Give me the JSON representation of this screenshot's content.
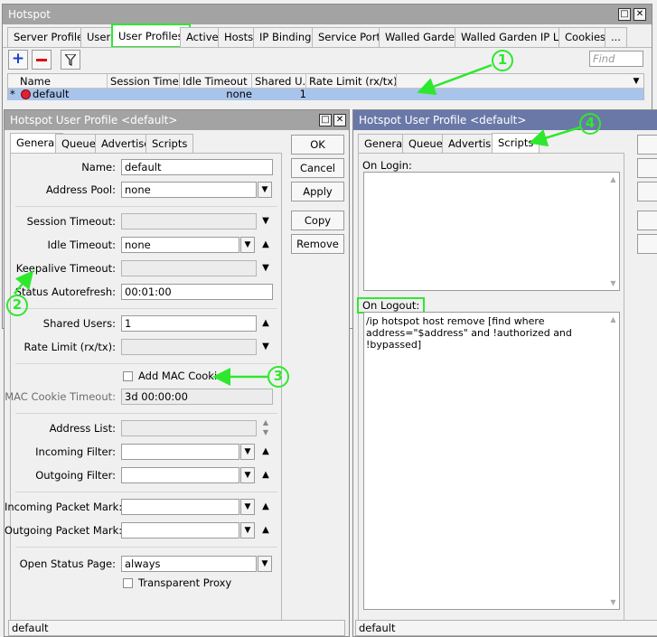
{
  "main": {
    "title": "Hotspot",
    "tabs": [
      "Server Profiles",
      "Users",
      "User Profiles",
      "Active",
      "Hosts",
      "IP Bindings",
      "Service Ports",
      "Walled Garden",
      "Walled Garden IP List",
      "Cookies",
      "..."
    ],
    "find_placeholder": "Find",
    "columns": [
      "Name",
      "Session Time...",
      "Idle Timeout",
      "Shared U...",
      "Rate Limit (rx/tx)"
    ],
    "row": {
      "marker": "*",
      "name": "default",
      "idle_timeout": "none",
      "shared_users": "1"
    }
  },
  "general_dialog": {
    "title": "Hotspot User Profile <default>",
    "tabs": [
      "General",
      "Queue",
      "Advertise",
      "Scripts"
    ],
    "buttons": {
      "ok": "OK",
      "cancel": "Cancel",
      "apply": "Apply",
      "copy": "Copy",
      "remove": "Remove"
    },
    "fields": {
      "name_label": "Name:",
      "name_value": "default",
      "address_pool_label": "Address Pool:",
      "address_pool_value": "none",
      "session_timeout_label": "Session Timeout:",
      "idle_timeout_label": "Idle Timeout:",
      "idle_timeout_value": "none",
      "keepalive_timeout_label": "Keepalive Timeout:",
      "status_autorefresh_label": "Status Autorefresh:",
      "status_autorefresh_value": "00:01:00",
      "shared_users_label": "Shared Users:",
      "shared_users_value": "1",
      "rate_limit_label": "Rate Limit (rx/tx):",
      "add_mac_cookie_label": "Add MAC Cookie",
      "mac_cookie_timeout_label": "MAC Cookie Timeout:",
      "mac_cookie_timeout_value": "3d 00:00:00",
      "address_list_label": "Address List:",
      "incoming_filter_label": "Incoming Filter:",
      "outgoing_filter_label": "Outgoing Filter:",
      "incoming_packet_mark_label": "Incoming Packet Mark:",
      "outgoing_packet_mark_label": "Outgoing Packet Mark:",
      "open_status_page_label": "Open Status Page:",
      "open_status_page_value": "always",
      "transparent_proxy_label": "Transparent Proxy"
    },
    "status": "default"
  },
  "scripts_dialog": {
    "title": "Hotspot User Profile <default>",
    "tabs": [
      "General",
      "Queue",
      "Advertise",
      "Scripts"
    ],
    "on_login_label": "On Login:",
    "on_logout_label": "On Logout:",
    "on_logout_value": "/ip hotspot host remove [find where address=\"$address\" and !authorized and !bypassed]",
    "status": "default"
  },
  "annotations": [
    "1",
    "2",
    "3",
    "4"
  ],
  "colors": {
    "annotation": "#2ee82e",
    "active_title": "#6a78a8",
    "inactive_title": "#a3a3a3",
    "selected_row": "#a9c4ea"
  }
}
